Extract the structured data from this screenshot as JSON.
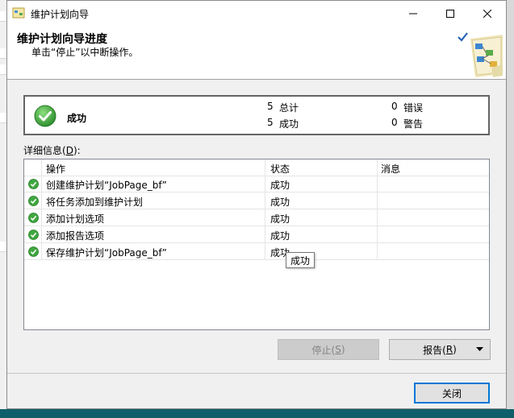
{
  "window": {
    "title": "维护计划向导",
    "controls": {
      "minimize": "minimize",
      "maximize": "maximize",
      "close": "close"
    }
  },
  "header": {
    "title": "维护计划向导进度",
    "subtitle": "单击“停止”以中断操作。",
    "graphic_icon": "wizard-graphic-icon"
  },
  "status": {
    "icon": "success-check-icon",
    "text": "成功",
    "total_count": "5",
    "total_label": "总计",
    "success_count": "5",
    "success_label": "成功",
    "error_count": "0",
    "error_label": "错误",
    "warning_count": "0",
    "warning_label": "警告"
  },
  "details": {
    "label_prefix": "详细信息(",
    "label_key": "D",
    "label_suffix": "):",
    "columns": [
      "操作",
      "状态",
      "消息"
    ],
    "rows": [
      {
        "operation": "创建维护计划“JobPage_bf”",
        "status": "成功",
        "message": ""
      },
      {
        "operation": "将任务添加到维护计划",
        "status": "成功",
        "message": ""
      },
      {
        "operation": "添加计划选项",
        "status": "成功",
        "message": ""
      },
      {
        "operation": "添加报告选项",
        "status": "成功",
        "message": ""
      },
      {
        "operation": "保存维护计划“JobPage_bf”",
        "status": "成功",
        "message": ""
      }
    ],
    "tooltip": "成功"
  },
  "buttons": {
    "stop_prefix": "停止(",
    "stop_key": "S",
    "stop_suffix": ")",
    "report_prefix": "报告(",
    "report_key": "R",
    "report_suffix": ")",
    "close": "关闭"
  },
  "colors": {
    "accent": "#0078d7",
    "success_green": "#3fa73f",
    "desktop": "#1e6b74"
  }
}
